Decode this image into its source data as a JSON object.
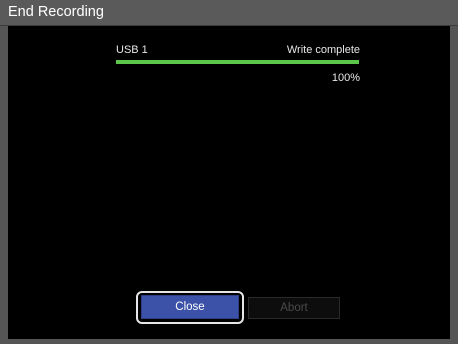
{
  "window": {
    "title": "End Recording"
  },
  "drive": {
    "name": "USB 1",
    "status": "Write complete",
    "progress_percent": 100,
    "progress_label": "100%",
    "progress_color": "#5cc64a"
  },
  "buttons": {
    "close_label": "Close",
    "abort_label": "Abort",
    "close_color": "#3b52a8"
  }
}
